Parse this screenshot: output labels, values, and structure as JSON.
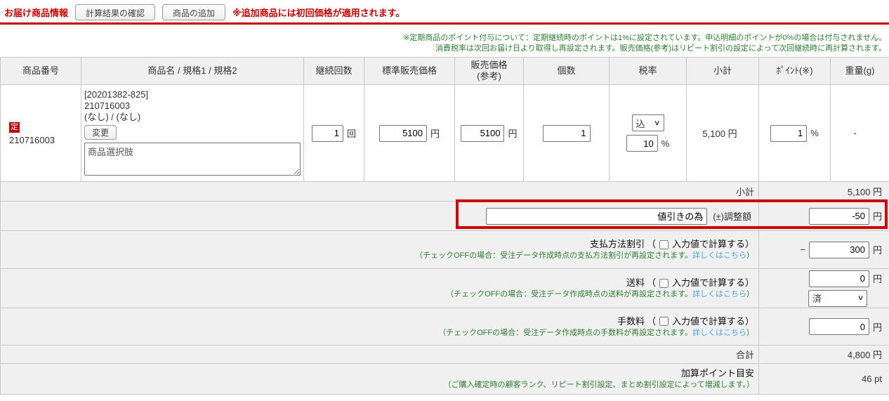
{
  "toolbar": {
    "title": "お届け商品情報",
    "check_button": "計算結果の確認",
    "add_button": "商品の追加",
    "warning": "※追加商品には初回価格が適用されます。"
  },
  "notes": {
    "line1": "※定期商品のポイント付与について：定期継続時のポイントは1%に設定されています。申込明細のポイントが0%の場合は付与されません。",
    "line2": "消費税率は次回お届け日より取得し再設定されます。販売価格(参考)はリピート割引の設定によって次回継続時に再計算されます。"
  },
  "table": {
    "headers": [
      {
        "line1": "商品番号",
        "line2": ""
      },
      {
        "line1": "商品名 / 規格1 / 規格2",
        "line2": ""
      },
      {
        "line1": "継続回数",
        "line2": ""
      },
      {
        "line1": "標準販売価格",
        "line2": ""
      },
      {
        "line1": "販売価格",
        "line2": "(参考)"
      },
      {
        "line1": "個数",
        "line2": ""
      },
      {
        "line1": "税率",
        "line2": ""
      },
      {
        "line1": "小計",
        "line2": ""
      },
      {
        "line1": "ﾎﾟｲﾝﾄ(※)",
        "line2": ""
      },
      {
        "line1": "重量(g)",
        "line2": ""
      }
    ]
  },
  "product": {
    "badge": "定",
    "code": "210716003",
    "bracket_code": "[20201382-825]",
    "name": "210716003",
    "specs": "(なし) / (なし)",
    "change_button": "変更",
    "option_text": "商品選択肢",
    "continue_count": "1",
    "continue_unit": "回",
    "standard_price": "5100",
    "reference_price": "5100",
    "yen": "円",
    "quantity": "1",
    "tax_type": "込",
    "tax_rate": "10",
    "percent": "%",
    "subtotal": "5,100 円",
    "point": "1",
    "weight": "-"
  },
  "summary": {
    "subtotal_label": "小計",
    "subtotal_value": "5,100 円",
    "adjustment": {
      "reason_value": "値引きの為",
      "label": "(±)調整額",
      "amount": "-50",
      "unit": "円"
    },
    "payment_discount": {
      "name": "支払方法割引",
      "paren_open": "（",
      "checkbox_text": "入力値で計算する）",
      "note": "（チェックOFFの場合：受注データ作成時点の支払方法割引が再設定されます。",
      "link": "詳しくはこちら",
      "note_close": "）",
      "minus": "−",
      "amount": "300",
      "unit": "円"
    },
    "shipping": {
      "name": "送料",
      "paren_open": "（",
      "checkbox_text": "入力値で計算する）",
      "note": "（チェックOFFの場合：受注データ作成時点の送料が再設定されます。",
      "link": "詳しくはこちら",
      "note_close": "）",
      "amount": "0",
      "unit": "円",
      "status": "済"
    },
    "fee": {
      "name": "手数料",
      "paren_open": "（",
      "checkbox_text": "入力値で計算する）",
      "note": "（チェックOFFの場合：受注データ作成時点の手数料が再設定されます。",
      "link": "詳しくはこちら",
      "note_close": "）",
      "amount": "0",
      "unit": "円"
    },
    "total_label": "合計",
    "total_value": "4,800 円",
    "points": {
      "label": "加算ポイント目安",
      "note": "（ご購入確定時の顧客ランク、リピート割引設定、まとめ割引設定によって増減します。）",
      "value": "46 pt"
    }
  }
}
